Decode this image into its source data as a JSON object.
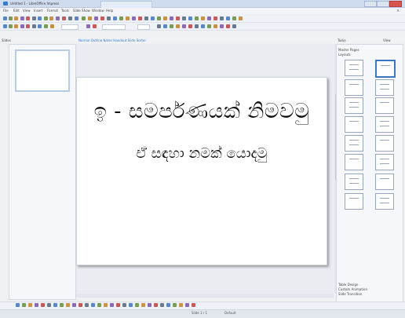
{
  "window": {
    "title": "Untitled 1 - LibreOffice Impress",
    "tab_label": ""
  },
  "menu": [
    "File",
    "Edit",
    "View",
    "Insert",
    "Format",
    "Tools",
    "Slide Show",
    "Window",
    "Help"
  ],
  "slides_pane": {
    "title": "Slides"
  },
  "tasks_pane": {
    "title": "Tasks",
    "view_label": "View",
    "sections": [
      "Master Pages",
      "Layouts"
    ],
    "footer_sections": [
      "Table Design",
      "Custom Animation",
      "Slide Transition"
    ]
  },
  "editor": {
    "tabs": "Normal  Outline  Notes  Handout  Slide Sorter",
    "slide_title": "ඉ - සමර්පණයක් නිමවමු",
    "slide_subtitle": "ඒ සඳහා නමක් යොදමු"
  },
  "thumbnail": {
    "title": "",
    "subtitle": ""
  },
  "status": {
    "position": "",
    "slide": "Slide 1 / 1",
    "layout": "Default",
    "zoom": ""
  },
  "colors": {
    "accent": "#3a78c4",
    "titlebar": "#cfdcef"
  }
}
